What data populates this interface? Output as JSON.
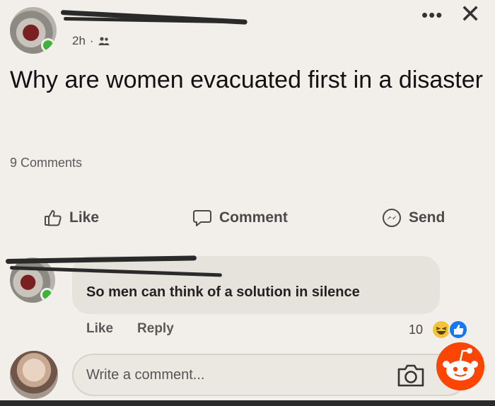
{
  "post": {
    "time": "2h",
    "separator": "·",
    "audience_icon": "friends-icon",
    "text": "Why are women evacuated first in a disaster",
    "comment_count": "9 Comments"
  },
  "actions": {
    "like": "Like",
    "comment": "Comment",
    "send": "Send"
  },
  "comment": {
    "text": "So men can think of a solution in silence",
    "like": "Like",
    "reply": "Reply",
    "reaction_count": "10",
    "reaction_icons": [
      "haha-icon",
      "like-icon"
    ]
  },
  "composer": {
    "placeholder": "Write a comment..."
  },
  "colors": {
    "online": "#3fb23c",
    "like_reaction": "#1877f2",
    "haha_reaction": "#f5c33b",
    "reddit_orange": "#ff4500"
  }
}
